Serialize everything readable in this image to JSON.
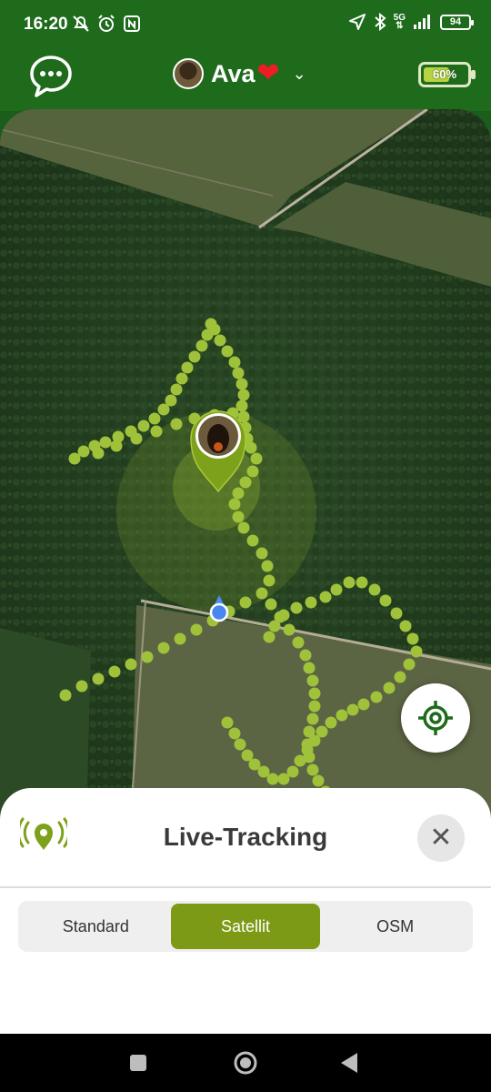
{
  "status_bar": {
    "time": "16:20",
    "network": "5G",
    "battery_level": "94",
    "icons": [
      "mute-icon",
      "alarm-icon",
      "nfc-icon",
      "location-arrow-icon",
      "bluetooth-icon",
      "signal-icon"
    ]
  },
  "header": {
    "chat_icon": "chat-bubble-icon",
    "dog_name": "Ava",
    "heart_icon": "heart-icon",
    "heart": "❤",
    "dropdown_icon": "chevron-down-icon",
    "chevron": "⌄",
    "tracker_battery": {
      "label": "60%",
      "level": 0.6
    }
  },
  "map": {
    "locate_icon": "crosshair-icon"
  },
  "bottom_sheet": {
    "title": "Live-Tracking",
    "title_icon": "live-location-icon",
    "close_label": "✕",
    "map_types": [
      {
        "label": "Standard",
        "active": false
      },
      {
        "label": "Satellit",
        "active": true
      },
      {
        "label": "OSM",
        "active": false
      }
    ]
  },
  "nav_bar": {
    "items": [
      "recents-square-icon",
      "home-circle-icon",
      "back-triangle-icon"
    ]
  },
  "colors": {
    "brand_green": "#1e6b1c",
    "accent_green": "#7c9a16",
    "track_dot": "#9fc23a",
    "close_bg": "#e6e6e6"
  }
}
